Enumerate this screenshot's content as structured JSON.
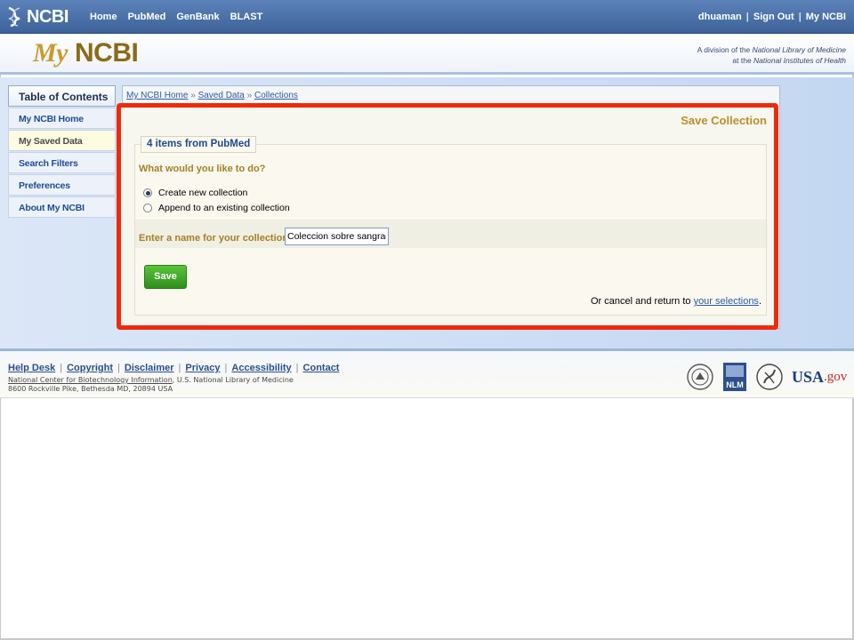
{
  "topbar": {
    "logo_text": "NCBI",
    "nav": [
      "Home",
      "PubMed",
      "GenBank",
      "BLAST"
    ],
    "user": "dhuaman",
    "sign_out": "Sign Out",
    "my_ncbi": "My NCBI",
    "separator": "|"
  },
  "brand": {
    "my": "My",
    "ncbi": "NCBI",
    "division_line1_prefix": "A division of the ",
    "division_line1_org": "National Library of Medicine",
    "division_line2_prefix": "at the ",
    "division_line2_org": "National Institutes of Health"
  },
  "sidebar": {
    "title": "Table of Contents",
    "items": [
      {
        "label": "My NCBI Home",
        "active": false
      },
      {
        "label": "My Saved Data",
        "active": true
      },
      {
        "label": "Search Filters",
        "active": false
      },
      {
        "label": "Preferences",
        "active": false
      },
      {
        "label": "About My NCBI",
        "active": false
      }
    ]
  },
  "breadcrumb": {
    "items": [
      "My NCBI Home",
      "Saved Data",
      "Collections"
    ],
    "separator": "»"
  },
  "form": {
    "title": "Save Collection",
    "legend": "4 items from PubMed",
    "question": "What would you like to do?",
    "options": [
      {
        "label": "Create new collection",
        "selected": true
      },
      {
        "label": "Append to an existing collection",
        "selected": false
      }
    ],
    "name_label": "Enter a name for your collection:",
    "name_value": "Coleccion sobre sangrado",
    "save_label": "Save",
    "cancel_prefix": "Or cancel and return to ",
    "cancel_link": "your selections",
    "cancel_suffix": "."
  },
  "footer": {
    "links": [
      "Help Desk",
      "Copyright",
      "Disclaimer",
      "Privacy",
      "Accessibility",
      "Contact"
    ],
    "separator": "|",
    "org_link": "National Center for Biotechnology Information",
    "org_suffix": ", U.S. National Library of Medicine",
    "address": "8600 Rockville Pike, Bethesda MD, 20894 USA",
    "logos": [
      "nih-seal-icon",
      "nlm-logo-icon",
      "hhs-logo-icon",
      "usagov-logo-icon"
    ],
    "nlm_text": "NLM",
    "usa_text": "USA",
    "gov_text": ".gov"
  },
  "colors": {
    "highlight_border": "#ef2a0c",
    "save_button": "#3aa524",
    "topbar": "#4a6fa8",
    "section_gold": "#b9902d"
  }
}
